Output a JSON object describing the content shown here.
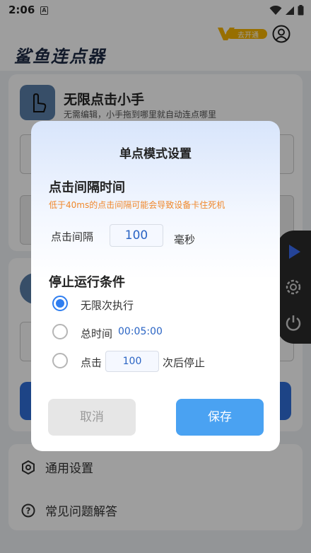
{
  "status_bar": {
    "time": "2:06",
    "notification_letter": "A"
  },
  "app": {
    "title": "鲨鱼连点器",
    "vip_label": "去开通",
    "feature": {
      "title": "无限点击小手",
      "desc": "无需编辑，小手拖到哪里就自动连点哪里"
    },
    "menu": [
      {
        "label": "通用设置",
        "icon": "settings-hex-icon"
      },
      {
        "label": "常见问题解答",
        "icon": "help-circle-icon"
      }
    ]
  },
  "dialog": {
    "title": "单点模式设置",
    "interval_section": {
      "title": "点击间隔时间",
      "warning": "低于40ms的点击间隔可能会导致设备卡住死机",
      "label": "点击间隔",
      "value": "100",
      "unit": "毫秒"
    },
    "stop_section": {
      "title": "停止运行条件",
      "options": [
        {
          "label": "无限次执行",
          "selected": true
        },
        {
          "label": "总时间",
          "value": "00:05:00",
          "selected": false
        },
        {
          "label": "点击",
          "value": "100",
          "suffix": "次后停止",
          "selected": false
        }
      ]
    },
    "buttons": {
      "cancel": "取消",
      "save": "保存"
    }
  },
  "colors": {
    "accent": "#2f7ef0",
    "save_button": "#4aa2f2",
    "warning": "#f0882b",
    "dark_panel": "#2b2b2b"
  }
}
